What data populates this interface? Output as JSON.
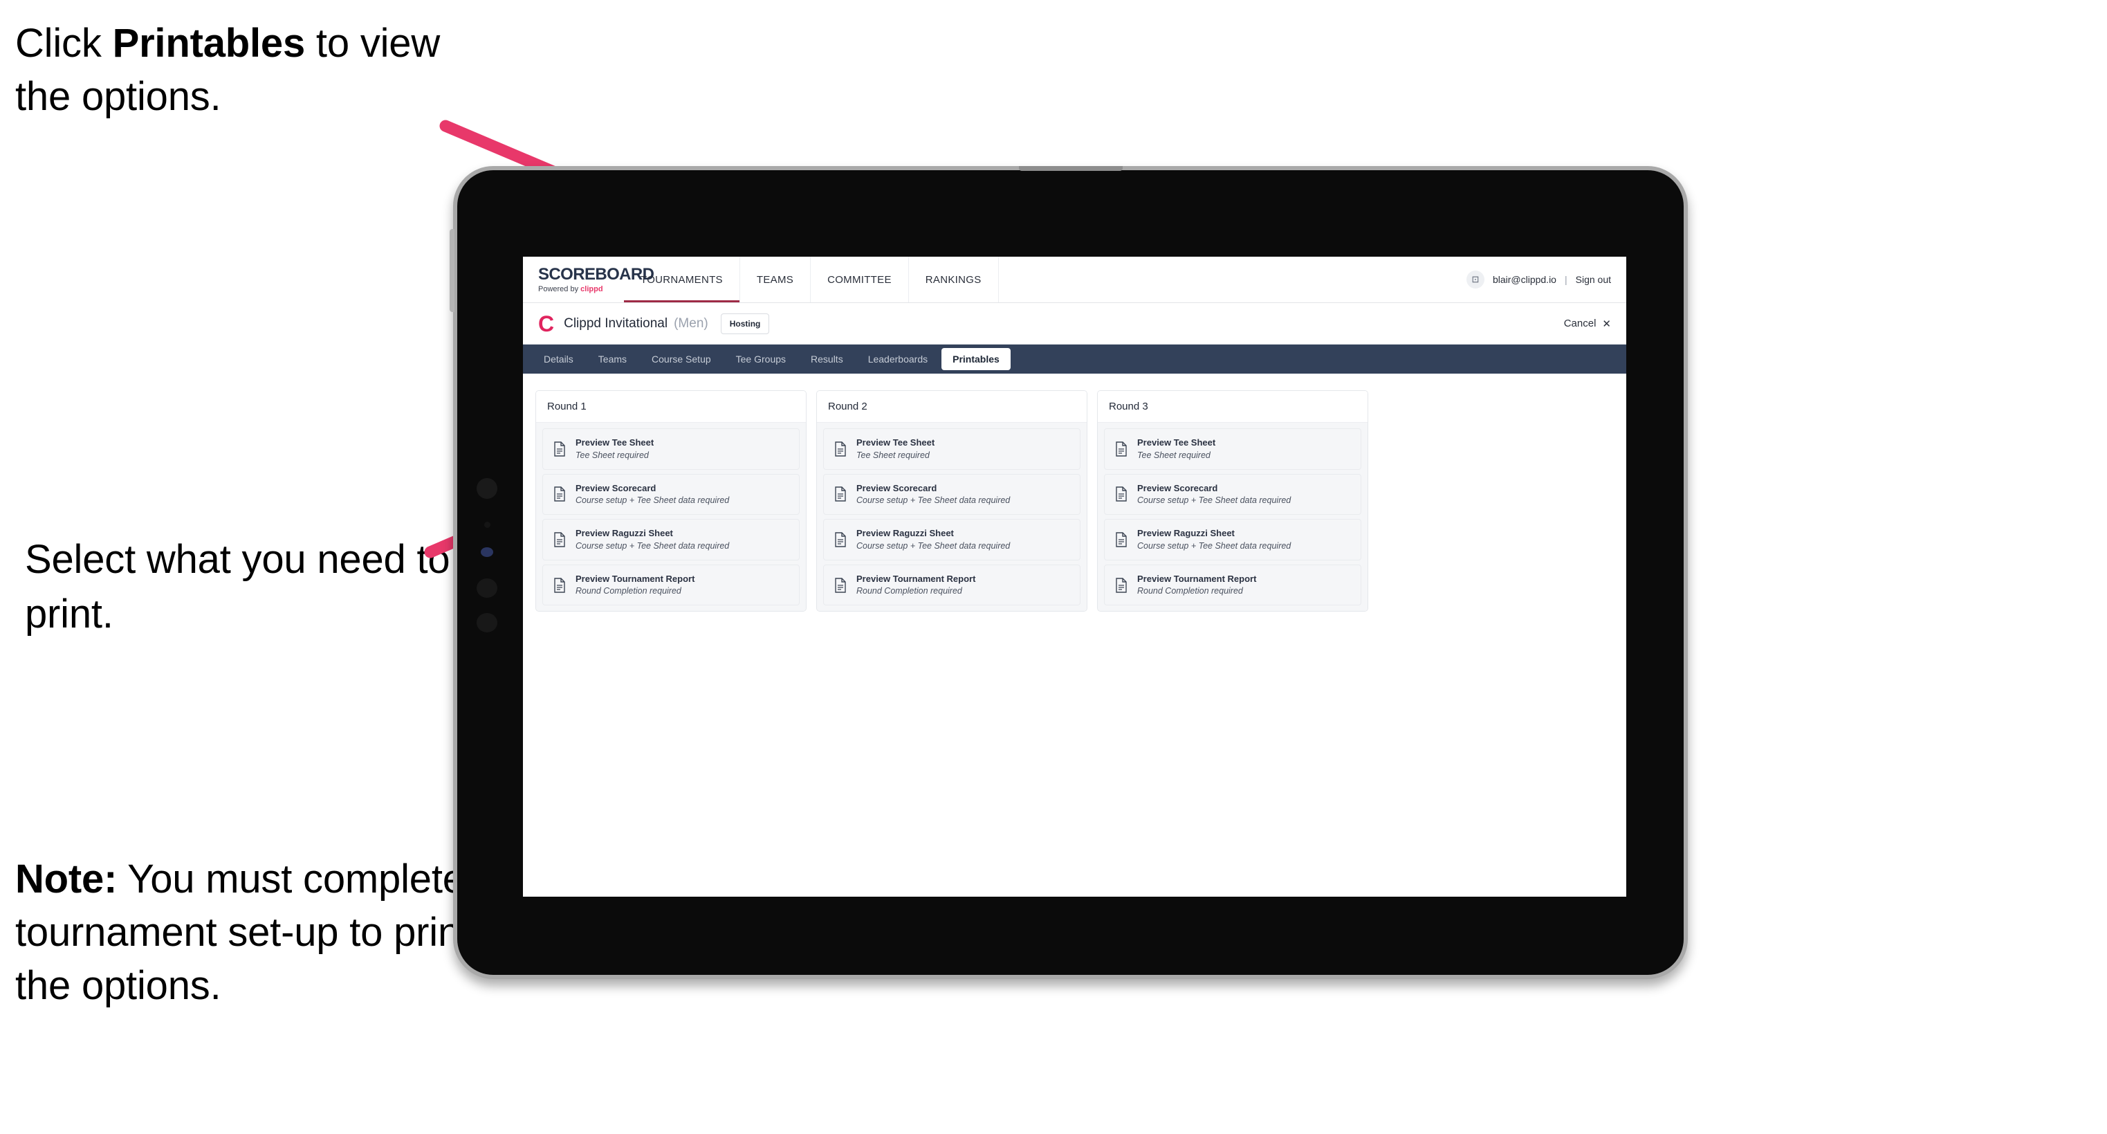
{
  "annotations": {
    "step1": {
      "pre": "Click ",
      "bold": "Printables",
      "post": " to view the options."
    },
    "step2": {
      "text": "Select what you need to print."
    },
    "note": {
      "bold": "Note:",
      "text": " You must complete the tournament set-up to print all the options."
    }
  },
  "colors": {
    "arrow_pink": "#e8386a",
    "brand_pink": "#e0245e",
    "tabstrip_navy": "#33415a",
    "active_underline": "#9e2b46"
  },
  "topnav": {
    "brand_title": "SCOREBOARD",
    "brand_sub_prefix": "Powered by ",
    "brand_sub_name": "clippd",
    "items": [
      {
        "label": "TOURNAMENTS",
        "active": true
      },
      {
        "label": "TEAMS",
        "active": false
      },
      {
        "label": "COMMITTEE",
        "active": false
      },
      {
        "label": "RANKINGS",
        "active": false
      }
    ],
    "avatar_glyph": "⊡",
    "user_email": "blair@clippd.io",
    "divider": "|",
    "sign_out": "Sign out"
  },
  "tournament": {
    "logo_letter": "C",
    "name": "Clippd Invitational",
    "gender": "(Men)",
    "status_badge": "Hosting",
    "cancel_label": "Cancel",
    "cancel_icon": "✕"
  },
  "tabs": [
    {
      "label": "Details",
      "active": false
    },
    {
      "label": "Teams",
      "active": false
    },
    {
      "label": "Course Setup",
      "active": false
    },
    {
      "label": "Tee Groups",
      "active": false
    },
    {
      "label": "Results",
      "active": false
    },
    {
      "label": "Leaderboards",
      "active": false
    },
    {
      "label": "Printables",
      "active": true
    }
  ],
  "rounds": [
    {
      "title": "Round 1",
      "items": [
        {
          "title": "Preview Tee Sheet",
          "sub": "Tee Sheet required"
        },
        {
          "title": "Preview Scorecard",
          "sub": "Course setup + Tee Sheet data required"
        },
        {
          "title": "Preview Raguzzi Sheet",
          "sub": "Course setup + Tee Sheet data required"
        },
        {
          "title": "Preview Tournament Report",
          "sub": "Round Completion required"
        }
      ]
    },
    {
      "title": "Round 2",
      "items": [
        {
          "title": "Preview Tee Sheet",
          "sub": "Tee Sheet required"
        },
        {
          "title": "Preview Scorecard",
          "sub": "Course setup + Tee Sheet data required"
        },
        {
          "title": "Preview Raguzzi Sheet",
          "sub": "Course setup + Tee Sheet data required"
        },
        {
          "title": "Preview Tournament Report",
          "sub": "Round Completion required"
        }
      ]
    },
    {
      "title": "Round 3",
      "items": [
        {
          "title": "Preview Tee Sheet",
          "sub": "Tee Sheet required"
        },
        {
          "title": "Preview Scorecard",
          "sub": "Course setup + Tee Sheet data required"
        },
        {
          "title": "Preview Raguzzi Sheet",
          "sub": "Course setup + Tee Sheet data required"
        },
        {
          "title": "Preview Tournament Report",
          "sub": "Round Completion required"
        }
      ]
    }
  ]
}
